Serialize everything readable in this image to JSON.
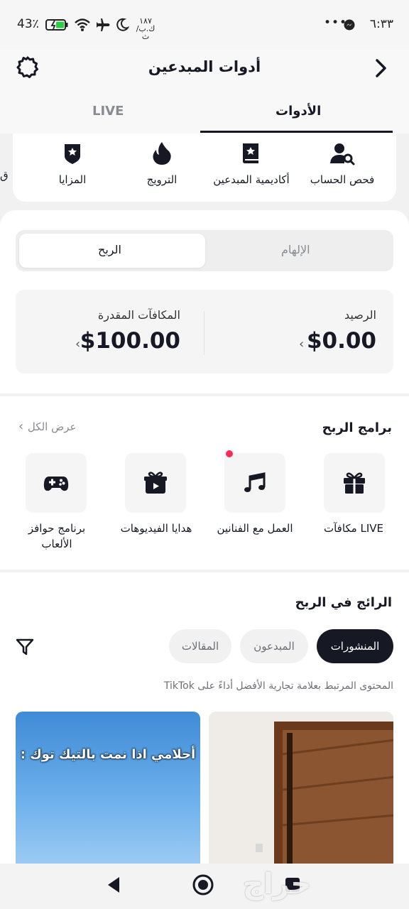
{
  "status_bar": {
    "time": "٦:٣٣",
    "battery": "43٪",
    "extra_text": "١٨٧ ك.ب/ث"
  },
  "header": {
    "title": "أدوات المبدعين",
    "back_icon": "chevron-right-icon",
    "settings_icon": "gear-icon"
  },
  "tabs": [
    {
      "label": "الأدوات",
      "active": true
    },
    {
      "label": "LIVE",
      "active": false
    }
  ],
  "tools": [
    {
      "label": "فحص الحساب",
      "icon": "person-search-icon"
    },
    {
      "label": "أكاديمية المبدعين",
      "icon": "book-star-icon"
    },
    {
      "label": "الترويج",
      "icon": "flame-icon"
    },
    {
      "label": "المزايا",
      "icon": "shield-star-icon"
    },
    {
      "label": "ق",
      "icon": ""
    }
  ],
  "segment": {
    "options": [
      "الإلهام",
      "الربح"
    ],
    "selected": "الربح"
  },
  "balance": {
    "label": "الرصيد",
    "value": "$0.00"
  },
  "estimated_rewards": {
    "label": "المكافآت المقدرة",
    "value": "$100.00"
  },
  "programs": {
    "title": "برامج الربح",
    "see_all": "عرض الكل",
    "items": [
      {
        "label": "مكافآت LIVE",
        "icon": "gift-icon"
      },
      {
        "label": "العمل مع الفنانين",
        "icon": "music-notes-icon",
        "has_dot": true
      },
      {
        "label": "هدايا الفيديوهات",
        "icon": "gift-play-icon"
      },
      {
        "label": "برنامج حوافز الألعاب",
        "icon": "gamepad-icon"
      }
    ]
  },
  "trending": {
    "title": "الرائج في الربح",
    "filters": [
      {
        "label": "المنشورات",
        "active": true
      },
      {
        "label": "المبدعون",
        "active": false
      },
      {
        "label": "المقالات",
        "active": false
      }
    ],
    "filter_icon": "filter-funnel-icon",
    "description": "المحتوى المرتبط بعلامة تجارية الأفضل أداءً على TikTok",
    "thumbnails": [
      {
        "caption": "",
        "scene": "wooden-door"
      },
      {
        "caption": "أحلامي اذا نمت بالتيك توك :",
        "scene": "blue-sky"
      }
    ]
  },
  "watermark": "حراج",
  "colors": {
    "text": "#161823",
    "accent_dot": "#fe2c55",
    "muted": "#8a8b91"
  }
}
